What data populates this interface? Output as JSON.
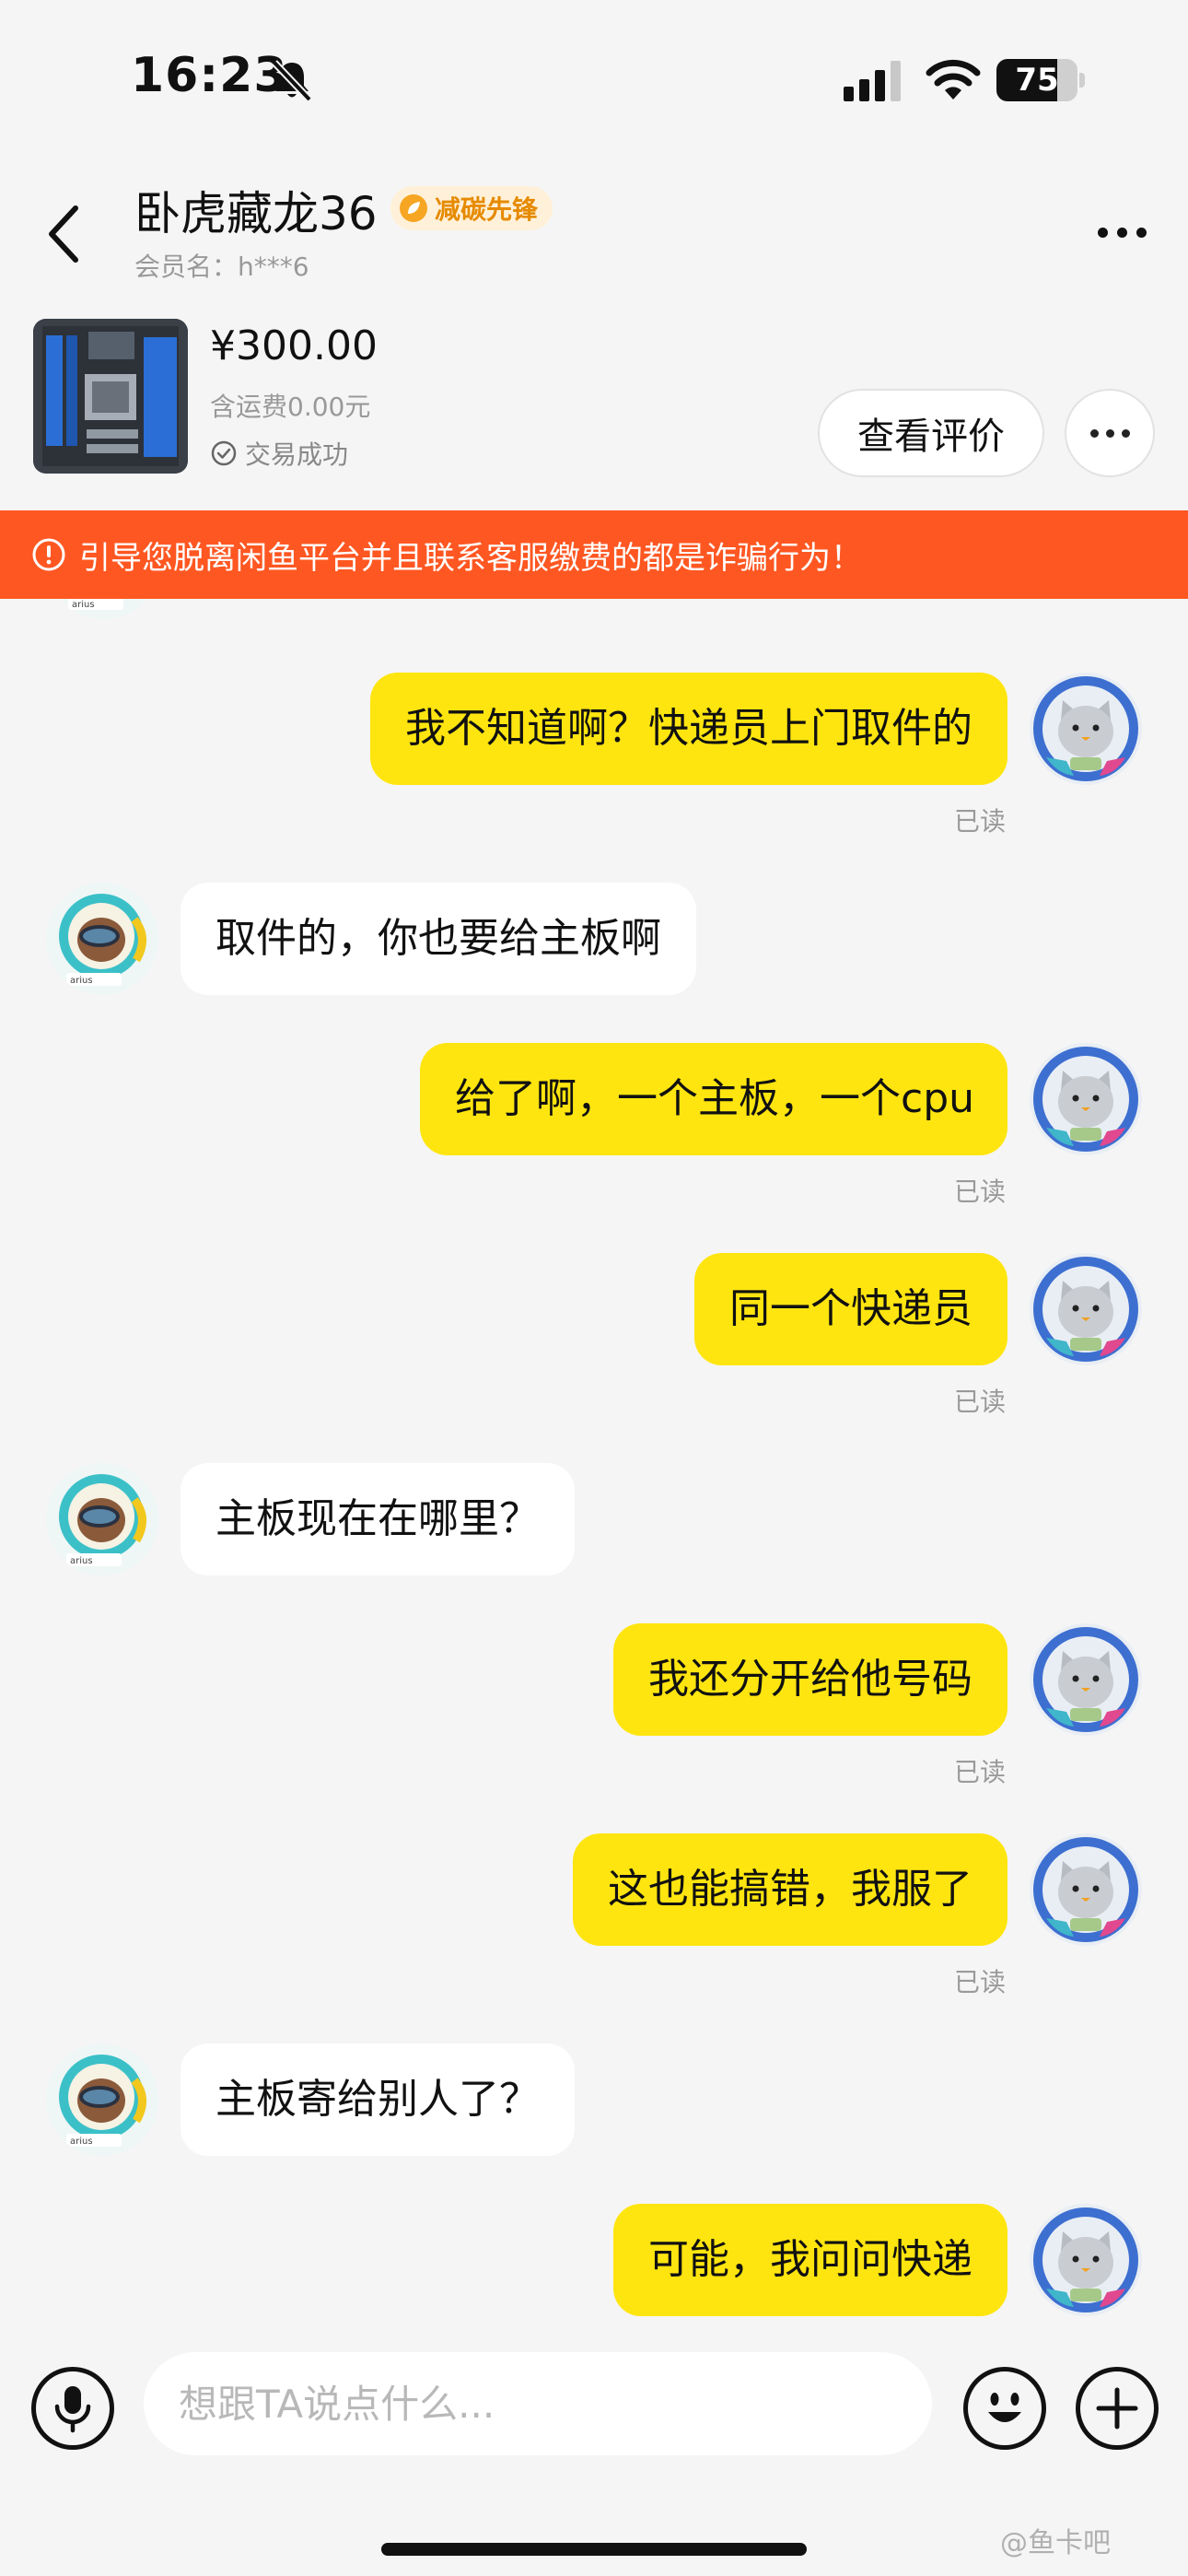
{
  "status_bar": {
    "time": "16:23",
    "battery_level": "75",
    "battery_fraction": 0.75,
    "icons": [
      "bell-slash-icon",
      "cellular-signal-icon",
      "wifi-icon",
      "battery-icon"
    ]
  },
  "header": {
    "seller_name": "卧虎藏龙36",
    "badge": "减碳先锋",
    "member_name": "会员名：h***6"
  },
  "product": {
    "price": "¥300.00",
    "shipping": "含运费0.00元",
    "status": "交易成功",
    "review_button": "查看评价"
  },
  "warning": {
    "text": "引导您脱离闲鱼平台并且联系客服缴费的都是诈骗行为！"
  },
  "messages": [
    {
      "side": "out",
      "text": "我不知道啊？快递员上门取件的",
      "read": "已读"
    },
    {
      "side": "in",
      "text": "取件的，你也要给主板啊"
    },
    {
      "side": "out",
      "text": "给了啊，一个主板，一个cpu",
      "read": "已读"
    },
    {
      "side": "out",
      "text": "同一个快递员",
      "read": "已读"
    },
    {
      "side": "in",
      "text": "主板现在在哪里？"
    },
    {
      "side": "out",
      "text": "我还分开给他号码",
      "read": "已读"
    },
    {
      "side": "out",
      "text": "这也能搞错，我服了",
      "read": "已读"
    },
    {
      "side": "in",
      "text": "主板寄给别人了？"
    },
    {
      "side": "out",
      "text": "可能，我问问快递"
    }
  ],
  "input": {
    "placeholder": "想跟TA说点什么..."
  },
  "watermark": "@鱼卡吧",
  "colors": {
    "accent_yellow": "#ffe50f",
    "warning_orange": "#ff5722",
    "badge_orange": "#e68a00"
  }
}
